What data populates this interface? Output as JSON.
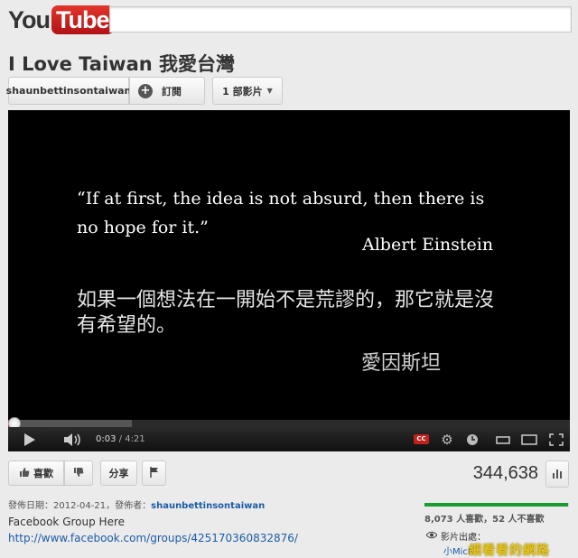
{
  "header": {
    "logo_you": "You",
    "logo_tube": "Tube"
  },
  "video": {
    "title": "I Love Taiwan 我愛台灣",
    "channel": "shaunbettinsontaiwan",
    "subscribe_label": "訂閱",
    "videos_label": "1 部影片"
  },
  "frame": {
    "quote_en": "“If at first, the idea is not absurd, then there is no hope for it.”",
    "author_en": "Albert Einstein",
    "quote_zh": "如果一個想法在一開始不是荒謬的，那它就是沒有希望的。",
    "author_zh": "愛因斯坦"
  },
  "player": {
    "current_time": "0:03",
    "duration": "/ 4:21",
    "played_fraction": 0.012,
    "buffered_fraction": 0.22,
    "cc_label": "CC",
    "icons": [
      "play-icon",
      "volume-icon",
      "cc-icon",
      "gear-icon",
      "clock-icon",
      "small-player-icon",
      "large-player-icon",
      "fullscreen-icon"
    ]
  },
  "actions": {
    "like_label": "喜歡",
    "share_label": "分享",
    "view_count": "344,638"
  },
  "meta": {
    "published": "發佈日期：2012-04-21，發佈者：",
    "uploader": "shaunbettinsontaiwan",
    "description_line1": "Facebook Group Here",
    "description_link": "http://www.facebook.com/groups/425170360832876/"
  },
  "ratings": {
    "summary": "8,073 人喜歡，52 人不喜歡",
    "like_fraction": 0.994,
    "origin_label": "影片出處：",
    "origin_link": "小MicR"
  },
  "watermark": "細看看的網路",
  "colors": {
    "accent_red": "#c0211a",
    "link_blue": "#1b5ba8",
    "rating_green": "#1a9c32"
  }
}
